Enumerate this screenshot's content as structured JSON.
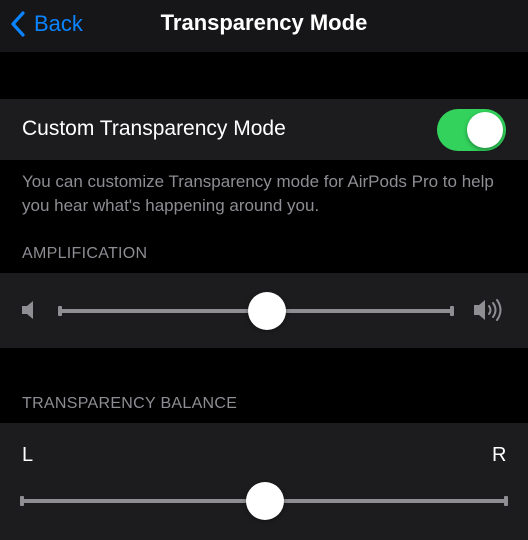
{
  "nav": {
    "back_label": "Back",
    "back_icon": "chevron-left-icon",
    "title": "Transparency Mode"
  },
  "custom_transparency": {
    "label": "Custom Transparency Mode",
    "enabled": true,
    "switch_on_color": "#32d25c",
    "footer": "You can customize Transparency mode for AirPods Pro to help you hear what's happening around you."
  },
  "amplification": {
    "header": "AMPLIFICATION",
    "min_icon": "speaker-low-icon",
    "max_icon": "speaker-high-icon",
    "value_fraction": 0.5
  },
  "balance": {
    "header": "TRANSPARENCY BALANCE",
    "left_label": "L",
    "right_label": "R",
    "value_fraction": 0.5
  },
  "colors": {
    "accent": "#0a84ff",
    "background": "#000000",
    "cell": "#1c1c1e",
    "secondary_text": "#8d8d93"
  }
}
